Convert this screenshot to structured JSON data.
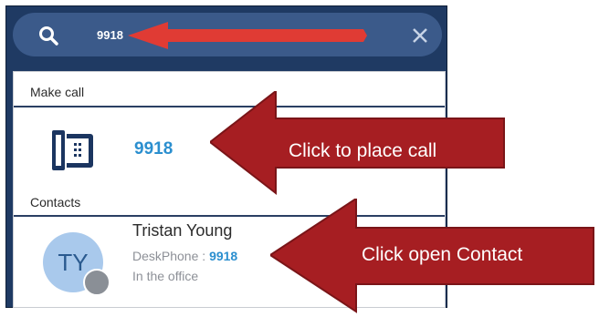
{
  "search": {
    "query": "9918"
  },
  "dropdown": {
    "make_call_label": "Make call",
    "call_number": "9918",
    "contacts_label": "Contacts",
    "contact": {
      "initials": "TY",
      "name": "Tristan Young",
      "phone_label": "DeskPhone : ",
      "phone_number": "9918",
      "status": "In the office"
    }
  },
  "annotations": {
    "place_call": "Click to place call",
    "open_contact": "Click open Contact"
  },
  "colors": {
    "navy": "#1f3a63",
    "search_bar": "#3b5a8a",
    "accent_blue": "#2b8fcf",
    "annotation_red": "#a61e22"
  },
  "icons": [
    "search-icon",
    "close-icon",
    "deskphone-icon",
    "avatar",
    "presence-dot",
    "arrow-left"
  ]
}
